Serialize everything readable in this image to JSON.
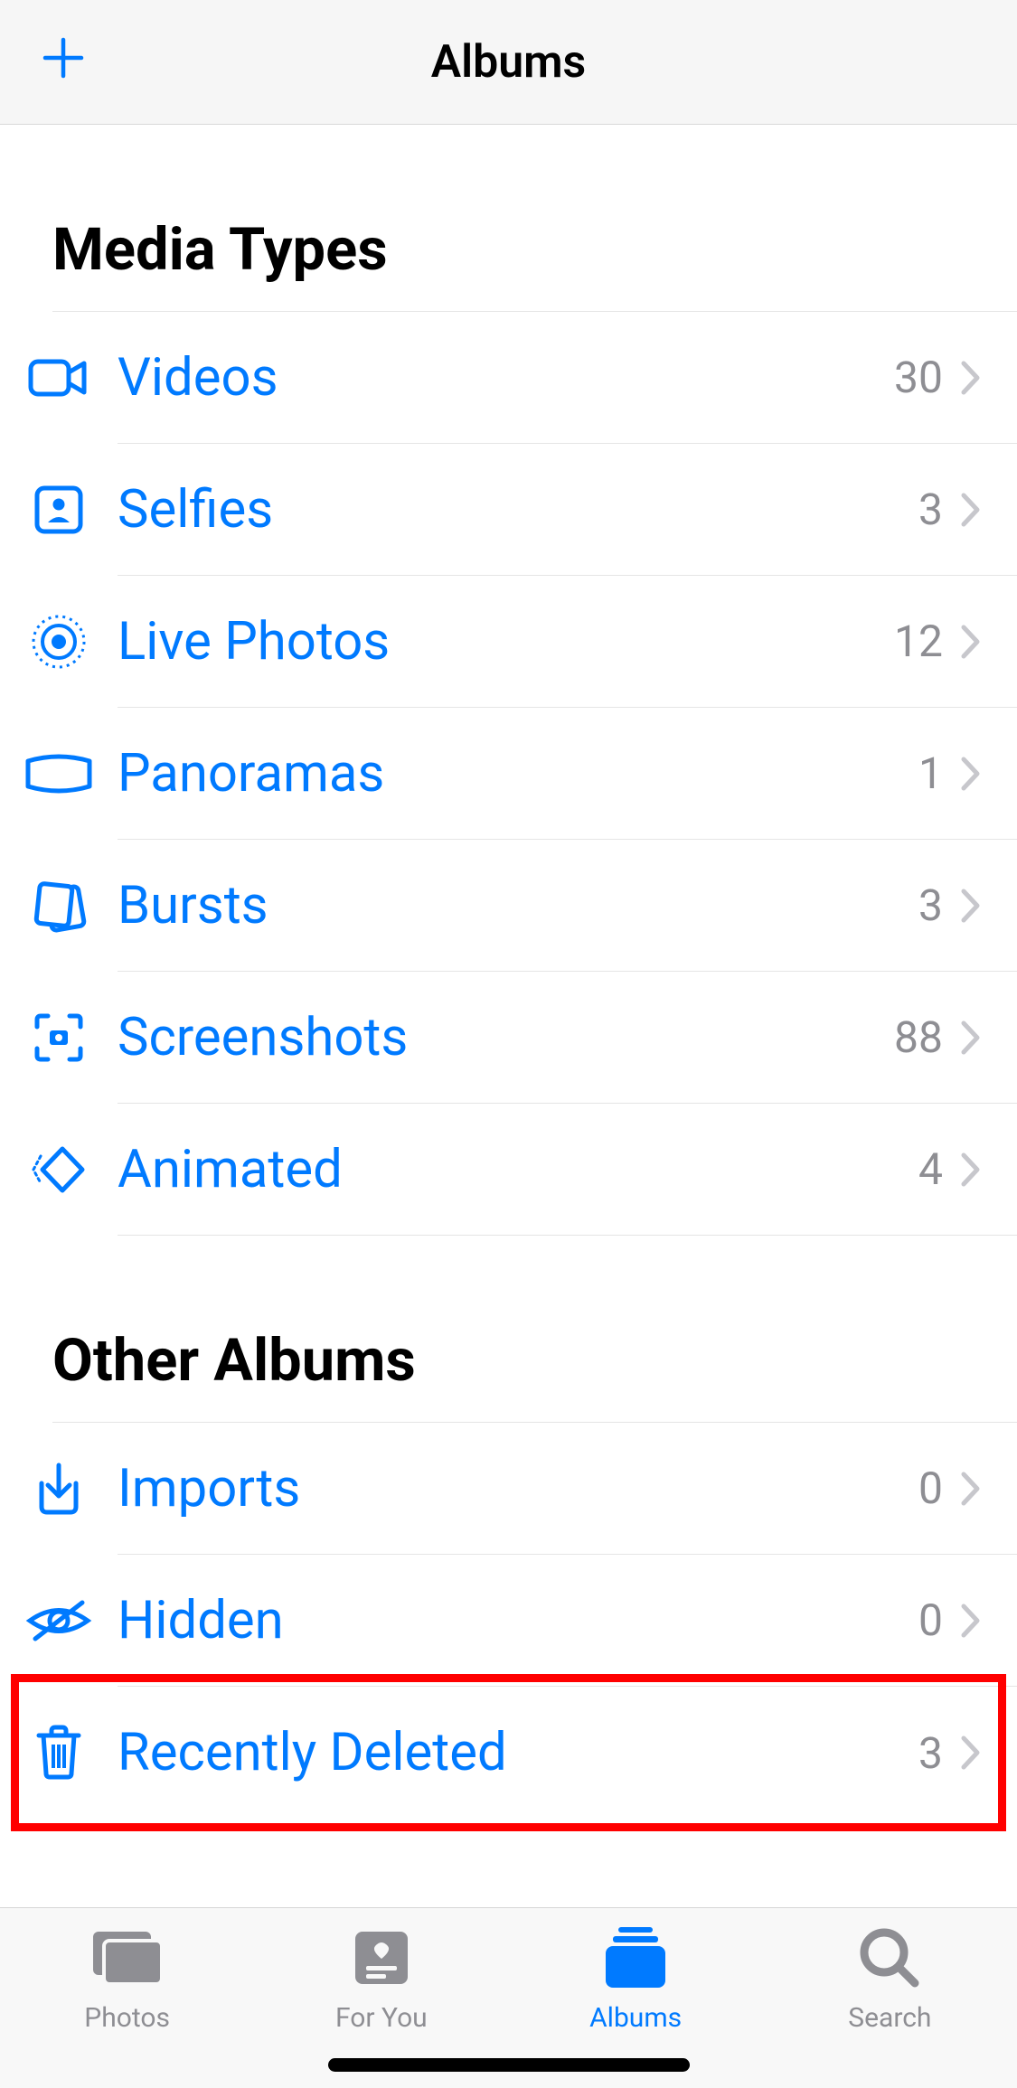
{
  "header": {
    "title": "Albums",
    "plus_label": "+"
  },
  "sections": {
    "media_types": {
      "title": "Media Types",
      "rows": [
        {
          "label": "Videos",
          "count": "30",
          "icon": "video-icon"
        },
        {
          "label": "Selfies",
          "count": "3",
          "icon": "selfie-icon"
        },
        {
          "label": "Live Photos",
          "count": "12",
          "icon": "live-photo-icon"
        },
        {
          "label": "Panoramas",
          "count": "1",
          "icon": "panorama-icon"
        },
        {
          "label": "Bursts",
          "count": "3",
          "icon": "burst-icon"
        },
        {
          "label": "Screenshots",
          "count": "88",
          "icon": "screenshot-icon"
        },
        {
          "label": "Animated",
          "count": "4",
          "icon": "animated-icon"
        }
      ]
    },
    "other_albums": {
      "title": "Other Albums",
      "rows": [
        {
          "label": "Imports",
          "count": "0",
          "icon": "import-icon"
        },
        {
          "label": "Hidden",
          "count": "0",
          "icon": "hidden-icon"
        },
        {
          "label": "Recently Deleted",
          "count": "3",
          "icon": "trash-icon",
          "highlighted": true
        }
      ]
    }
  },
  "tabs": [
    {
      "label": "Photos",
      "icon": "photos-tab-icon",
      "active": false
    },
    {
      "label": "For You",
      "icon": "foryou-tab-icon",
      "active": false
    },
    {
      "label": "Albums",
      "icon": "albums-tab-icon",
      "active": true
    },
    {
      "label": "Search",
      "icon": "search-tab-icon",
      "active": false
    }
  ],
  "colors": {
    "accent": "#007aff",
    "inactive": "#8e8e93",
    "highlight": "#ff0000"
  }
}
